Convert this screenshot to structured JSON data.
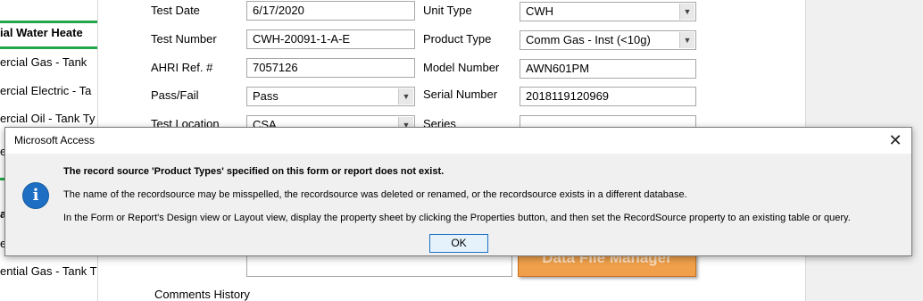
{
  "nav": {
    "heading_top": "ial Water Heate",
    "items": [
      "ercial Gas - Tank",
      "ercial Electric - Ta",
      "ercial Oil - Tank Ty"
    ],
    "fragment_e": "e",
    "heading_mid": "a",
    "fragment_r": "er",
    "item_low": "ential Gas - Tank T"
  },
  "form": {
    "test_date": {
      "label": "Test Date",
      "value": "6/17/2020"
    },
    "unit_type": {
      "label": "Unit Type",
      "value": "CWH"
    },
    "test_number": {
      "label": "Test Number",
      "value": "CWH-20091-1-A-E"
    },
    "product_type": {
      "label": "Product Type",
      "value": "Comm Gas - Inst (<10g)"
    },
    "ahri_ref": {
      "label": "AHRI Ref. #",
      "value": "7057126"
    },
    "model_number": {
      "label": "Model Number",
      "value": "AWN601PM"
    },
    "pass_fail": {
      "label": "Pass/Fail",
      "value": "Pass"
    },
    "serial_number": {
      "label": "Serial Number",
      "value": "2018119120969"
    },
    "test_location": {
      "label": "Test Location",
      "value": "CSA"
    },
    "series": {
      "label": "Series",
      "value": ""
    },
    "comments_history_label": "Comments History",
    "data_file_manager_label": "Data File Manager"
  },
  "dialog": {
    "title": "Microsoft Access",
    "close_glyph": "✕",
    "icon_glyph": "i",
    "line1": "The record source 'Product Types' specified on this form or report does not exist.",
    "line2": "The name of the recordsource may be misspelled, the recordsource was deleted or renamed, or the recordsource exists in a different database.",
    "line3": "In the Form or Report's Design view or Layout view, display the property sheet by clicking the Properties button, and then set the RecordSource property to an existing table or query.",
    "ok_label": "OK"
  },
  "colors": {
    "accent_green": "#22a84a",
    "info_blue": "#1e6fc4",
    "orange_button": "#f0a04a"
  }
}
